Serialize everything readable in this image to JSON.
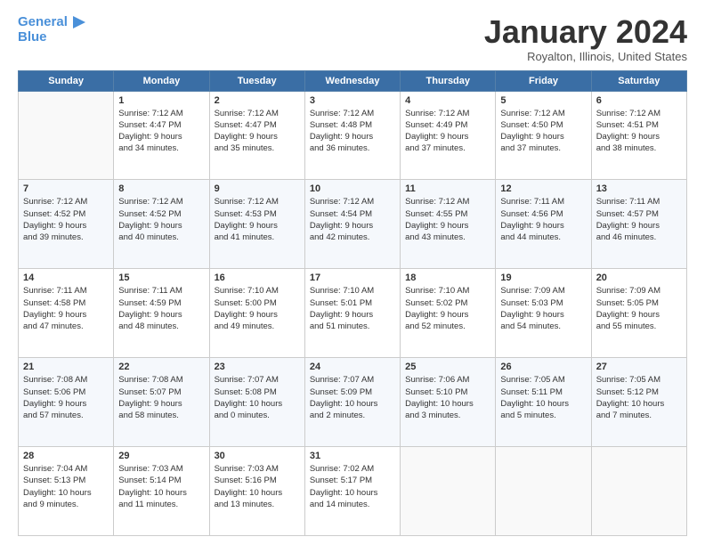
{
  "header": {
    "logo_line1": "General",
    "logo_line2": "Blue",
    "month_title": "January 2024",
    "subtitle": "Royalton, Illinois, United States"
  },
  "weekdays": [
    "Sunday",
    "Monday",
    "Tuesday",
    "Wednesday",
    "Thursday",
    "Friday",
    "Saturday"
  ],
  "weeks": [
    [
      {
        "day": "",
        "info": ""
      },
      {
        "day": "1",
        "info": "Sunrise: 7:12 AM\nSunset: 4:47 PM\nDaylight: 9 hours\nand 34 minutes."
      },
      {
        "day": "2",
        "info": "Sunrise: 7:12 AM\nSunset: 4:47 PM\nDaylight: 9 hours\nand 35 minutes."
      },
      {
        "day": "3",
        "info": "Sunrise: 7:12 AM\nSunset: 4:48 PM\nDaylight: 9 hours\nand 36 minutes."
      },
      {
        "day": "4",
        "info": "Sunrise: 7:12 AM\nSunset: 4:49 PM\nDaylight: 9 hours\nand 37 minutes."
      },
      {
        "day": "5",
        "info": "Sunrise: 7:12 AM\nSunset: 4:50 PM\nDaylight: 9 hours\nand 37 minutes."
      },
      {
        "day": "6",
        "info": "Sunrise: 7:12 AM\nSunset: 4:51 PM\nDaylight: 9 hours\nand 38 minutes."
      }
    ],
    [
      {
        "day": "7",
        "info": "Sunrise: 7:12 AM\nSunset: 4:52 PM\nDaylight: 9 hours\nand 39 minutes."
      },
      {
        "day": "8",
        "info": "Sunrise: 7:12 AM\nSunset: 4:52 PM\nDaylight: 9 hours\nand 40 minutes."
      },
      {
        "day": "9",
        "info": "Sunrise: 7:12 AM\nSunset: 4:53 PM\nDaylight: 9 hours\nand 41 minutes."
      },
      {
        "day": "10",
        "info": "Sunrise: 7:12 AM\nSunset: 4:54 PM\nDaylight: 9 hours\nand 42 minutes."
      },
      {
        "day": "11",
        "info": "Sunrise: 7:12 AM\nSunset: 4:55 PM\nDaylight: 9 hours\nand 43 minutes."
      },
      {
        "day": "12",
        "info": "Sunrise: 7:11 AM\nSunset: 4:56 PM\nDaylight: 9 hours\nand 44 minutes."
      },
      {
        "day": "13",
        "info": "Sunrise: 7:11 AM\nSunset: 4:57 PM\nDaylight: 9 hours\nand 46 minutes."
      }
    ],
    [
      {
        "day": "14",
        "info": "Sunrise: 7:11 AM\nSunset: 4:58 PM\nDaylight: 9 hours\nand 47 minutes."
      },
      {
        "day": "15",
        "info": "Sunrise: 7:11 AM\nSunset: 4:59 PM\nDaylight: 9 hours\nand 48 minutes."
      },
      {
        "day": "16",
        "info": "Sunrise: 7:10 AM\nSunset: 5:00 PM\nDaylight: 9 hours\nand 49 minutes."
      },
      {
        "day": "17",
        "info": "Sunrise: 7:10 AM\nSunset: 5:01 PM\nDaylight: 9 hours\nand 51 minutes."
      },
      {
        "day": "18",
        "info": "Sunrise: 7:10 AM\nSunset: 5:02 PM\nDaylight: 9 hours\nand 52 minutes."
      },
      {
        "day": "19",
        "info": "Sunrise: 7:09 AM\nSunset: 5:03 PM\nDaylight: 9 hours\nand 54 minutes."
      },
      {
        "day": "20",
        "info": "Sunrise: 7:09 AM\nSunset: 5:05 PM\nDaylight: 9 hours\nand 55 minutes."
      }
    ],
    [
      {
        "day": "21",
        "info": "Sunrise: 7:08 AM\nSunset: 5:06 PM\nDaylight: 9 hours\nand 57 minutes."
      },
      {
        "day": "22",
        "info": "Sunrise: 7:08 AM\nSunset: 5:07 PM\nDaylight: 9 hours\nand 58 minutes."
      },
      {
        "day": "23",
        "info": "Sunrise: 7:07 AM\nSunset: 5:08 PM\nDaylight: 10 hours\nand 0 minutes."
      },
      {
        "day": "24",
        "info": "Sunrise: 7:07 AM\nSunset: 5:09 PM\nDaylight: 10 hours\nand 2 minutes."
      },
      {
        "day": "25",
        "info": "Sunrise: 7:06 AM\nSunset: 5:10 PM\nDaylight: 10 hours\nand 3 minutes."
      },
      {
        "day": "26",
        "info": "Sunrise: 7:05 AM\nSunset: 5:11 PM\nDaylight: 10 hours\nand 5 minutes."
      },
      {
        "day": "27",
        "info": "Sunrise: 7:05 AM\nSunset: 5:12 PM\nDaylight: 10 hours\nand 7 minutes."
      }
    ],
    [
      {
        "day": "28",
        "info": "Sunrise: 7:04 AM\nSunset: 5:13 PM\nDaylight: 10 hours\nand 9 minutes."
      },
      {
        "day": "29",
        "info": "Sunrise: 7:03 AM\nSunset: 5:14 PM\nDaylight: 10 hours\nand 11 minutes."
      },
      {
        "day": "30",
        "info": "Sunrise: 7:03 AM\nSunset: 5:16 PM\nDaylight: 10 hours\nand 13 minutes."
      },
      {
        "day": "31",
        "info": "Sunrise: 7:02 AM\nSunset: 5:17 PM\nDaylight: 10 hours\nand 14 minutes."
      },
      {
        "day": "",
        "info": ""
      },
      {
        "day": "",
        "info": ""
      },
      {
        "day": "",
        "info": ""
      }
    ]
  ]
}
